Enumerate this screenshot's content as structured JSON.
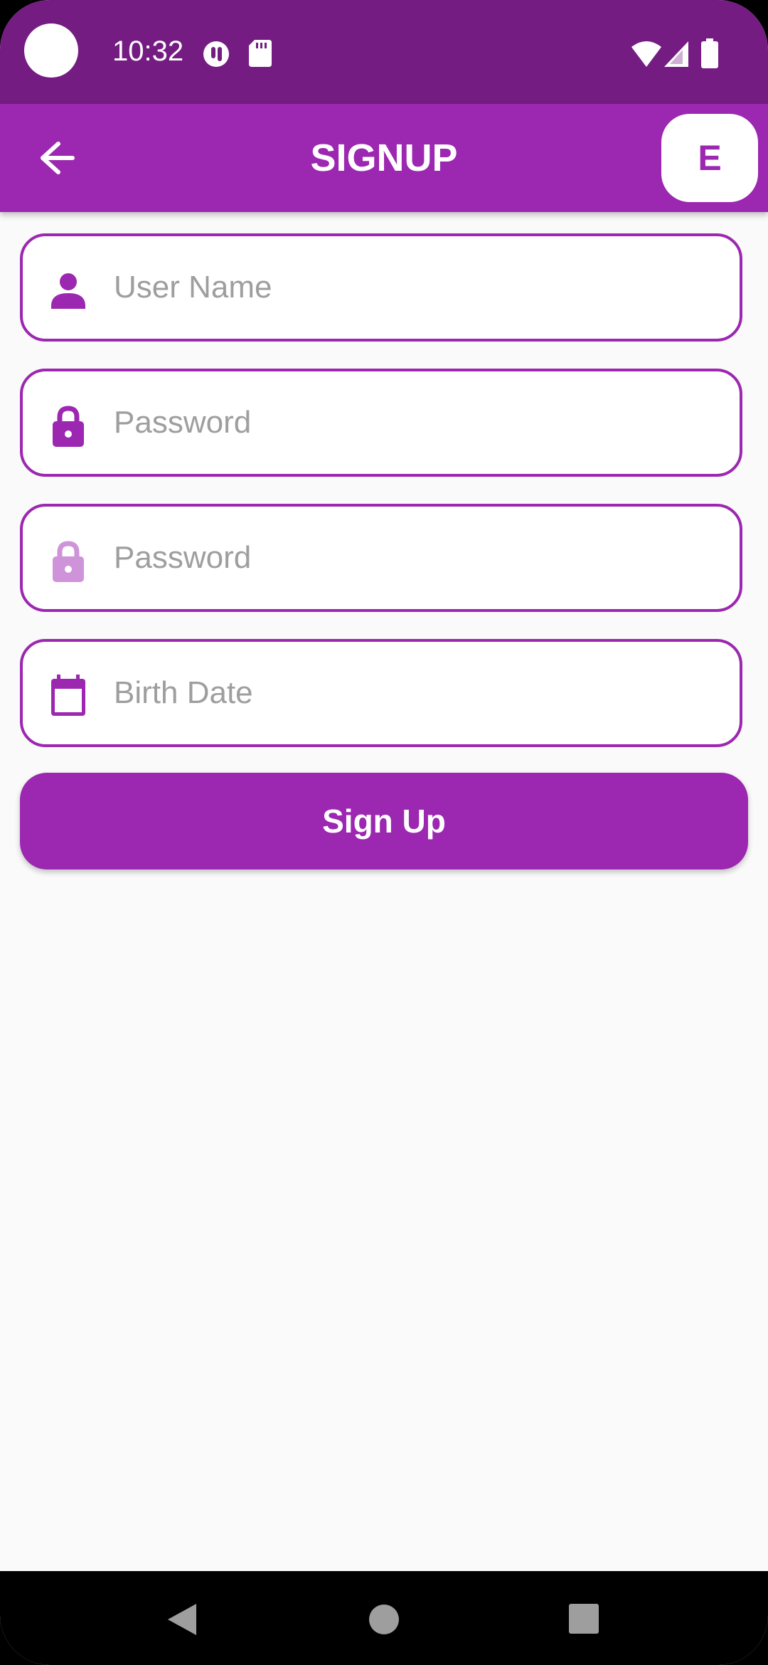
{
  "status_bar": {
    "time": "10:32",
    "icons": [
      "camera-cutout",
      "sync-status-icon",
      "sd-card-icon",
      "wifi-icon",
      "signal-icon",
      "battery-icon"
    ]
  },
  "app_bar": {
    "title": "SIGNUP",
    "back_icon": "arrow-left-icon",
    "action_label": "E"
  },
  "form": {
    "fields": [
      {
        "icon": "person-icon",
        "placeholder": "User Name",
        "value": ""
      },
      {
        "icon": "lock-icon",
        "placeholder": "Password",
        "value": ""
      },
      {
        "icon": "lock-icon-faded",
        "placeholder": "Password",
        "value": ""
      },
      {
        "icon": "calendar-icon",
        "placeholder": "Birth Date",
        "value": ""
      }
    ],
    "submit_label": "Sign Up"
  },
  "nav_bar": {
    "buttons": [
      "back-triangle-icon",
      "home-circle-icon",
      "recents-square-icon"
    ]
  },
  "colors": {
    "status_bar": "#751c83",
    "primary": "#9c27b0",
    "primary_light": "#ce93d8",
    "background": "#fafafa",
    "placeholder": "#9e9e9e"
  }
}
